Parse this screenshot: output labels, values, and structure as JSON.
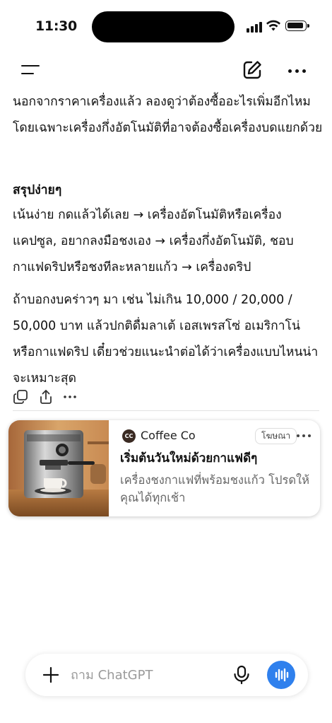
{
  "status_bar": {
    "time": "11:30"
  },
  "top_nav": {
    "menu_icon": "hamburger-menu-icon",
    "compose_icon": "compose-icon",
    "more_icon": "more-horizontal-icon"
  },
  "message": {
    "intro_paragraph": "นอกจากราคาเครื่องแล้ว ลองดูว่าต้องซื้ออะไรเพิ่มอีกไหม โดยเฉพาะเครื่องกึ่งอัตโนมัติที่อาจต้องซื้อเครื่องบดแยกด้วย",
    "summary_heading": "สรุปง่ายๆ",
    "summary_paragraph": "เน้นง่าย กดแล้วได้เลย → เครื่องอัตโนมัติหรือเครื่องแคปซูล, อยากลงมือชงเอง → เครื่องกึ่งอัตโนมัติ, ชอบกาแฟดริปหรือชงทีละหลายแก้ว → เครื่องดริป",
    "followup_paragraph": "ถ้าบอกงบคร่าวๆ มา เช่น ไม่เกิน 10,000 / 20,000 / 50,000 บาท แล้วปกติดื่มลาเต้ เอสเพรสโซ่ อเมริกาโน่ หรือกาแฟดริป เดี๋ยวช่วยแนะนำต่อได้ว่าเครื่องแบบไหนน่าจะเหมาะสุด",
    "actions": [
      "copy-icon",
      "share-icon",
      "more-horizontal-icon"
    ]
  },
  "ad": {
    "brand_initials": "CC",
    "brand_name": "Coffee Co",
    "sponsored_label": "โฆษณา",
    "headline": "เริ่มต้นวันใหม่ด้วยกาแฟดีๆ",
    "body": "เครื่องชงกาแฟที่พร้อมชงแก้ว โปรดให้คุณได้ทุกเช้า",
    "image_icon": "espresso-machine-image",
    "brand_color": "#3a2a22"
  },
  "composer": {
    "placeholder": "ถาม ChatGPT",
    "value": "",
    "plus_icon": "plus-icon",
    "mic_icon": "microphone-icon",
    "voice_icon": "voice-mode-icon",
    "accent": "#2f80ed"
  }
}
